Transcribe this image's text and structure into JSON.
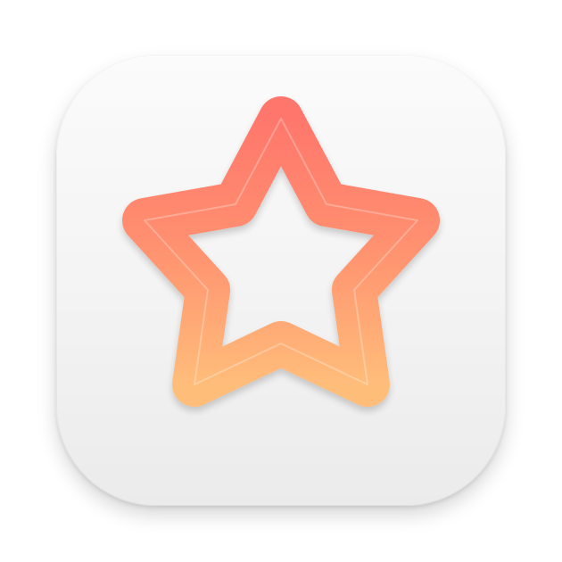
{
  "app_icon": {
    "icon": "star-outline-icon",
    "background_color": "#f2f2f2",
    "star_gradient_top": "#ff7a6e",
    "star_gradient_bottom": "#ffbc7b"
  }
}
